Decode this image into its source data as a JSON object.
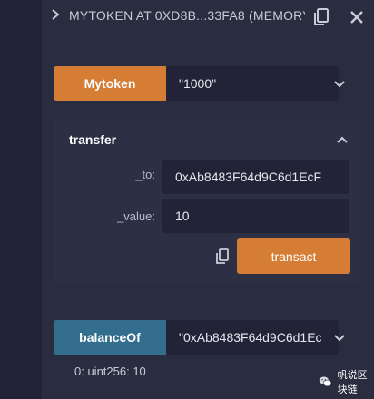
{
  "header": {
    "title": "MYTOKEN AT 0XD8B...33FA8 (MEMORY)"
  },
  "constructor_row": {
    "button_label": "Mytoken",
    "input_value": "\"1000\""
  },
  "transfer": {
    "title": "transfer",
    "fields": [
      {
        "label": "_to:",
        "value": "0xAb8483F64d9C6d1EcF"
      },
      {
        "label": "_value:",
        "value": "10"
      }
    ],
    "transact_label": "transact"
  },
  "balance_row": {
    "button_label": "balanceOf",
    "input_value": "\"0xAb8483F64d9C6d1Ec"
  },
  "result": {
    "text": "0: uint256: 10"
  },
  "watermark": {
    "text": "帆说区块链"
  },
  "colors": {
    "orange": "#d57d35",
    "blue": "#336e8e",
    "background": "#2a2c3f",
    "input_bg": "#222336"
  },
  "icons": {
    "header_chevron": "chevron-right-icon",
    "copy": "copy-icon",
    "close": "close-icon",
    "expand": "chevron-down-icon",
    "collapse": "chevron-up-icon",
    "wechat": "wechat-icon"
  }
}
